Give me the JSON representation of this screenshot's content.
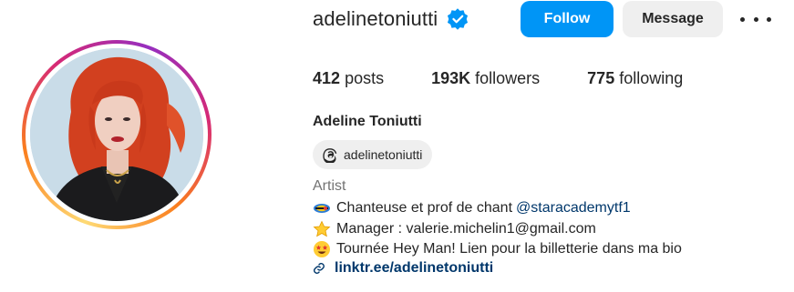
{
  "profile": {
    "username": "adelinetoniutti",
    "full_name": "Adeline Toniutti",
    "threads_handle": "adelinetoniutti",
    "category": "Artist"
  },
  "actions": {
    "follow_label": "Follow",
    "message_label": "Message"
  },
  "stats": {
    "posts_count": "412",
    "posts_label": "posts",
    "followers_count": "193K",
    "followers_label": "followers",
    "following_count": "775",
    "following_label": "following"
  },
  "bio": {
    "line1_text": "Chanteuse et prof de chant",
    "line1_mention": "@staracademytf1",
    "line2_text": "Manager : valerie.michelin1@gmail.com",
    "line3_text": "Tournée Hey Man! Lien pour la billetterie dans ma bio",
    "link": "linktr.ee/adelinetoniutti"
  },
  "icons": {
    "verified": "verified-badge-icon",
    "threads": "threads-icon",
    "bio1": "microphone-emoji-icon",
    "bio2": "star-emoji-icon",
    "bio3": "star-struck-emoji-icon",
    "link": "link-icon",
    "more": "more-options-icon"
  },
  "colors": {
    "accent": "#0095f6",
    "link": "#00376b",
    "secondary_text": "#737373",
    "button_gray": "#efefef"
  }
}
